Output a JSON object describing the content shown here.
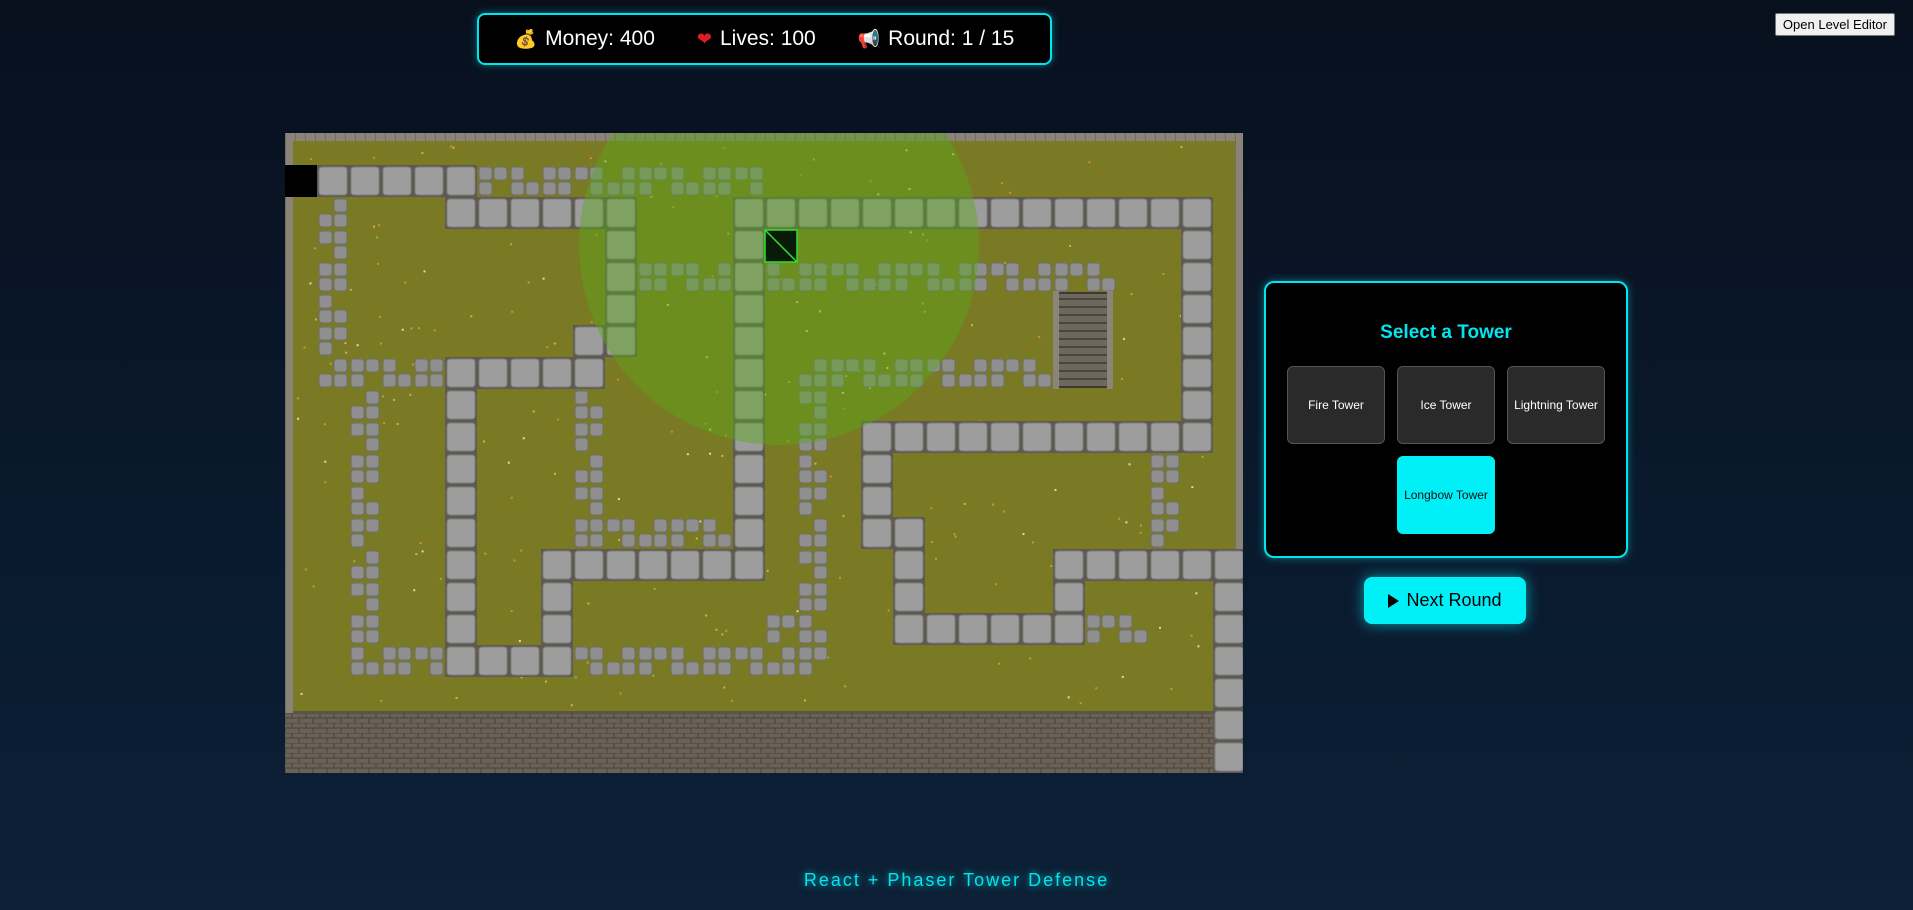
{
  "hud": {
    "money_icon": "money-bag-icon",
    "money": "Money: 400",
    "lives_icon": "heart-icon",
    "lives": "Lives: 100",
    "round_icon": "megaphone-icon",
    "round": "Round: 1 / 15"
  },
  "editor": {
    "label": "Open Level Editor"
  },
  "tower_panel": {
    "title": "Select a Tower",
    "towers": [
      {
        "label": "Fire Tower",
        "selected": false
      },
      {
        "label": "Ice Tower",
        "selected": false
      },
      {
        "label": "Lightning Tower",
        "selected": false
      },
      {
        "label": "Longbow Tower",
        "selected": true
      }
    ]
  },
  "next_round": {
    "label": "Next Round",
    "icon": "play-icon"
  },
  "footer": {
    "text": "React + Phaser Tower Defense"
  },
  "colors": {
    "accent": "#00e5ee",
    "grass": "#7a7a24",
    "path_stone": "#9d9d9d",
    "tower_range": "#5aa61a"
  }
}
